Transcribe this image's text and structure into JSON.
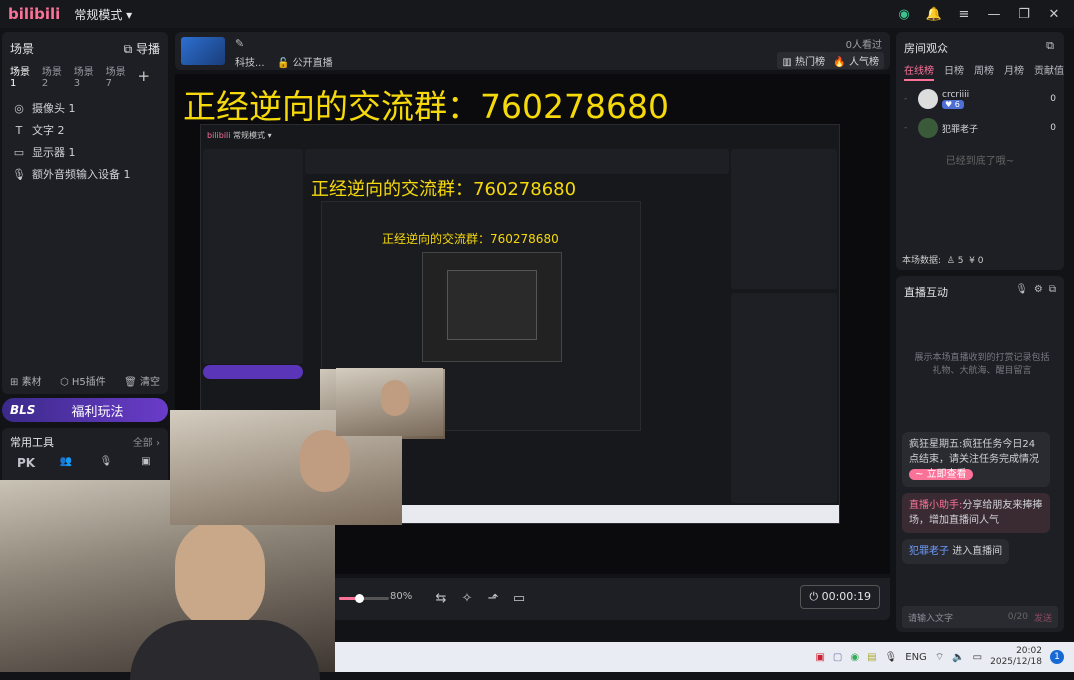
{
  "app": {
    "logo": "bilibili",
    "mode": "常规模式"
  },
  "scenes": {
    "title": "场景",
    "guide": "导播",
    "tabs": [
      "场景1",
      "场景2",
      "场景3",
      "场景7"
    ],
    "items": [
      {
        "icon": "camera-icon",
        "label": "摄像头 1"
      },
      {
        "icon": "text-icon",
        "label": "文字 2"
      },
      {
        "icon": "monitor-icon",
        "label": "显示器 1"
      },
      {
        "icon": "mic-icon",
        "label": "额外音频输入设备 1"
      }
    ],
    "footer": [
      "素材",
      "H5插件",
      "清空"
    ]
  },
  "welfare": {
    "badge": "BLS",
    "label": "福利玩法"
  },
  "tools": {
    "title": "常用工具",
    "all": "全部",
    "items": [
      "PK",
      "连线",
      "语音",
      "任务"
    ]
  },
  "stream": {
    "title": "科技...",
    "live": "公开直播",
    "viewers": "0人看过",
    "hot": "热门榜",
    "popular": "人气榜"
  },
  "overlay_text": "正经逆向的交流群：760278680",
  "controls": {
    "volume": "80%",
    "timer": "00:00:19"
  },
  "room": {
    "title": "房间观众",
    "tabs": [
      "在线榜",
      "日榜",
      "周榜",
      "月榜",
      "贡献值"
    ],
    "users": [
      {
        "name": "crcriiii",
        "level": "6",
        "score": "0"
      },
      {
        "name": "犯罪老子",
        "score": "0"
      }
    ],
    "end": "已经到底了哦~",
    "stats_label": "本场数据:",
    "stat1": "5",
    "stat2": "0"
  },
  "interact": {
    "title": "直播互动",
    "hint": "展示本场直播收到的打赏记录包括礼物、大航海、醒目留言",
    "msgs": [
      {
        "name": "疯狂星期五:",
        "text": "疯狂任务今日24点结束，请关注任务完成情况",
        "btn": "立即查看"
      },
      {
        "name": "直播小助手:",
        "text": "分享给朋友来捧捧场，增加直播间人气"
      },
      {
        "name": "犯罪老子",
        "text": "进入直播间"
      }
    ],
    "placeholder": "请输入文字",
    "count": "0/20",
    "send": "发送"
  },
  "taskbar": {
    "lang": "ENG",
    "time": "20:02",
    "date": "2025/12/18",
    "badge": "1"
  }
}
